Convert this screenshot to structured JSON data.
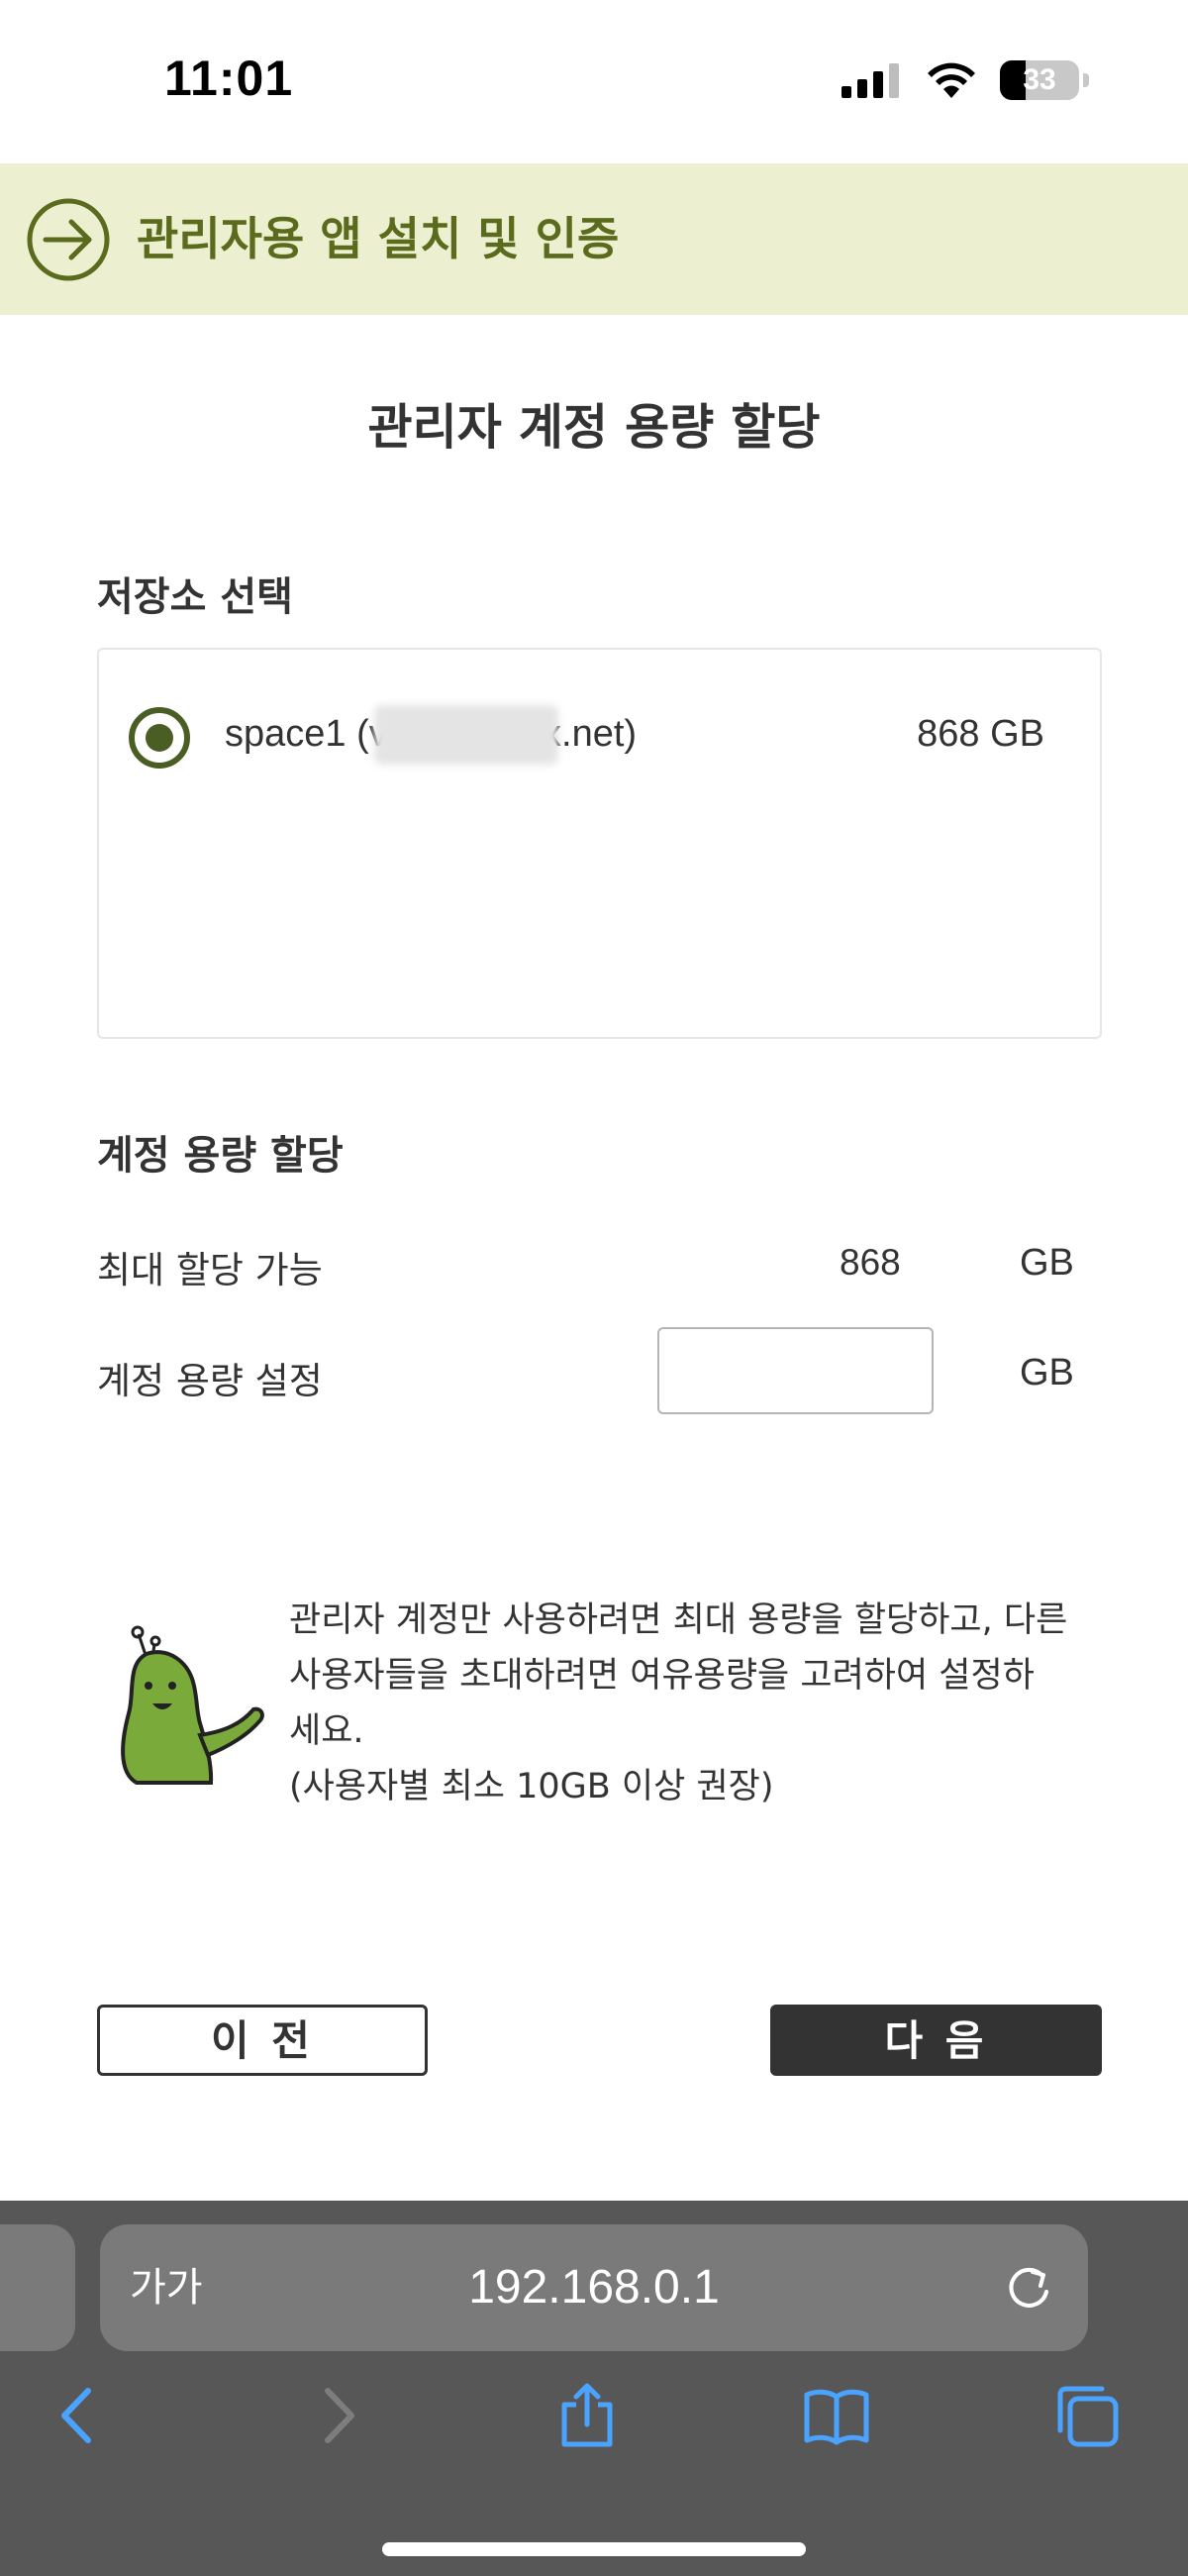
{
  "status_bar": {
    "time": "11:01",
    "battery_level": "33",
    "icons": [
      "signal-icon",
      "wifi-icon",
      "battery-icon"
    ]
  },
  "banner": {
    "title": "관리자용 앱 설치 및 인증",
    "icon": "arrow-right-circle-icon"
  },
  "page": {
    "title": "관리자 계정 용량 할당"
  },
  "storage": {
    "section_label": "저장소 선택",
    "items": [
      {
        "name": "space1 (v            s.acrobox.net)",
        "size": "868 GB",
        "selected": true
      }
    ]
  },
  "capacity": {
    "section_label": "계정 용량 할당",
    "max_label": "최대 할당 가능",
    "max_value": "868",
    "max_unit": "GB",
    "set_label": "계정 용량 설정",
    "set_value": "",
    "set_unit": "GB"
  },
  "info": {
    "line1": "관리자 계정만 사용하려면 최대 용량을 할당하고, 다른",
    "line2": "사용자들을 초대하려면 여유용량을 고려하여 설정하",
    "line3": "세요.",
    "line4": "(사용자별 최소 10GB 이상 권장)"
  },
  "buttons": {
    "prev": "이 전",
    "next": "다 음"
  },
  "browser": {
    "text_size_label": "가가",
    "url": "192.168.0.1",
    "toolbar": [
      "back-icon",
      "forward-icon",
      "share-icon",
      "bookmarks-icon",
      "tabs-icon"
    ]
  },
  "colors": {
    "banner_bg": "#edf0d0",
    "banner_text": "#5b6b1d",
    "accent": "#4a5d23",
    "next_button": "#333333",
    "browser_chrome": "#575757",
    "browser_link": "#4aa3ff"
  }
}
